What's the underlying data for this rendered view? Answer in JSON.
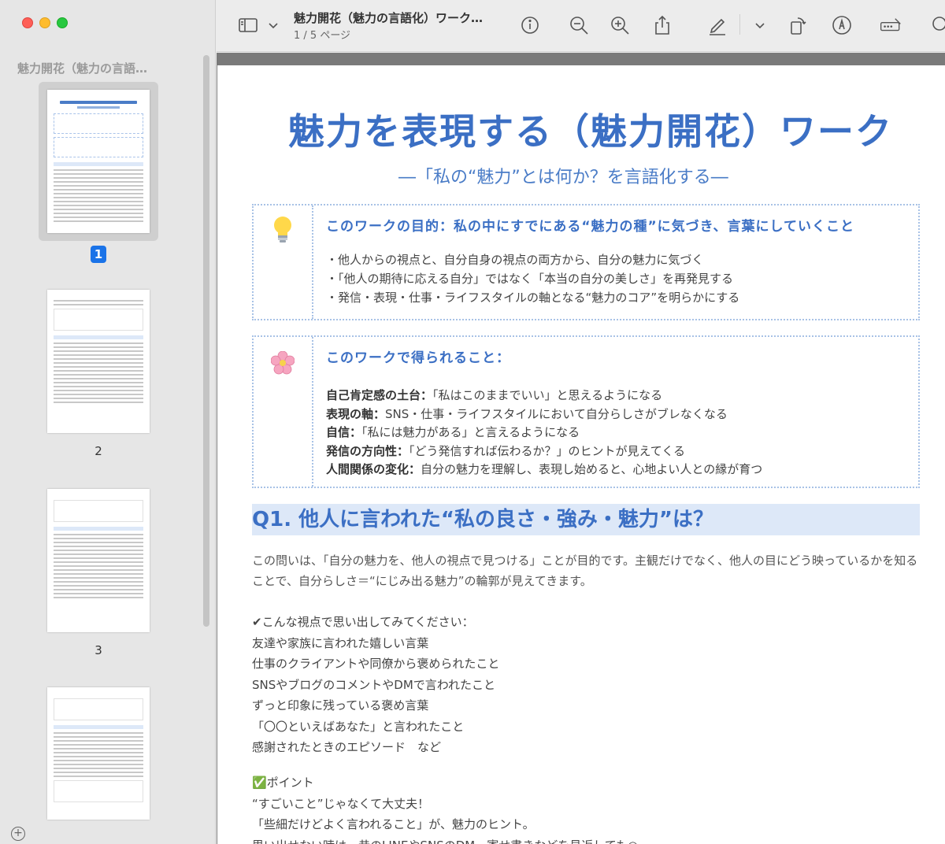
{
  "window": {
    "sidebar_title": "魅力開花（魅力の言語…",
    "doc_title": "魅力開花（魅力の言語化）ワーク…",
    "page_indicator": "1 / 5 ページ"
  },
  "thumbnails": [
    {
      "label": "1",
      "selected": true
    },
    {
      "label": "2",
      "selected": false
    },
    {
      "label": "3",
      "selected": false
    },
    {
      "label": "",
      "selected": false
    }
  ],
  "toolbar": {
    "icons": [
      "sidebar-icon",
      "chevron-down-icon",
      "info-icon",
      "zoom-out-icon",
      "zoom-in-icon",
      "share-icon",
      "markup-pen-icon",
      "chevron-down-icon",
      "rotate-icon",
      "annotate-icon",
      "form-fill-icon",
      "search-icon"
    ]
  },
  "page": {
    "title": "魅力を表現する（魅力開花）ワーク",
    "subtitle": "―「私の“魅力”とは何か？を言語化する―",
    "purpose": {
      "icon": "lightbulb-icon",
      "title": "このワークの目的：私の中にすでにある“魅力の種”に気づき、言葉にしていくこと",
      "items": [
        "・他人からの視点と、自分自身の視点の両方から、自分の魅力に気づく",
        "・「他人の期待に応える自分」ではなく「本当の自分の美しさ」を再発見する",
        "・発信・表現・仕事・ライフスタイルの軸となる“魅力のコア”を明らかにする"
      ]
    },
    "benefits": {
      "icon": "cherry-blossom-icon",
      "title": "このワークで得られること：",
      "items": [
        {
          "bold": "自己肯定感の土台：",
          "text": "「私はこのままでいい」と思えるようになる"
        },
        {
          "bold": "表現の軸：",
          "text": "SNS・仕事・ライフスタイルにおいて自分らしさがブレなくなる"
        },
        {
          "bold": "自信：",
          "text": "「私には魅力がある」と言えるようになる"
        },
        {
          "bold": "発信の方向性：",
          "text": "「どう発信すれば伝わるか？」のヒントが見えてくる"
        },
        {
          "bold": "人間関係の変化：",
          "text": "自分の魅力を理解し、表現し始めると、心地よい人との縁が育つ"
        }
      ]
    },
    "q1": {
      "heading": "Q1. 他人に言われた“私の良さ・強み・魅力”は？",
      "intro": "この問いは、「自分の魅力を、他人の視点で見つける」ことが目的です。主観だけでなく、他人の目にどう映っているかを知ることで、自分らしさ＝“にじみ出る魅力”の輪郭が見えてきます。",
      "lines": [
        "✔こんな視点で思い出してみてください：",
        "友達や家族に言われた嬉しい言葉",
        "仕事のクライアントや同僚から褒められたこと",
        "SNSやブログのコメントやDMで言われたこと",
        "ずっと印象に残っている褒め言葉",
        "「〇〇といえばあなた」と言われたこと",
        "感謝されたときのエピソード　など"
      ],
      "point_lines": [
        "✅ポイント",
        "“すごいこと”じゃなくて大丈夫！",
        "「些細だけどよく言われること」が、魅力のヒント。",
        "思い出せない時は、昔のLINEやSNSのDM、寄せ書きなどを見返しても◎"
      ]
    }
  }
}
